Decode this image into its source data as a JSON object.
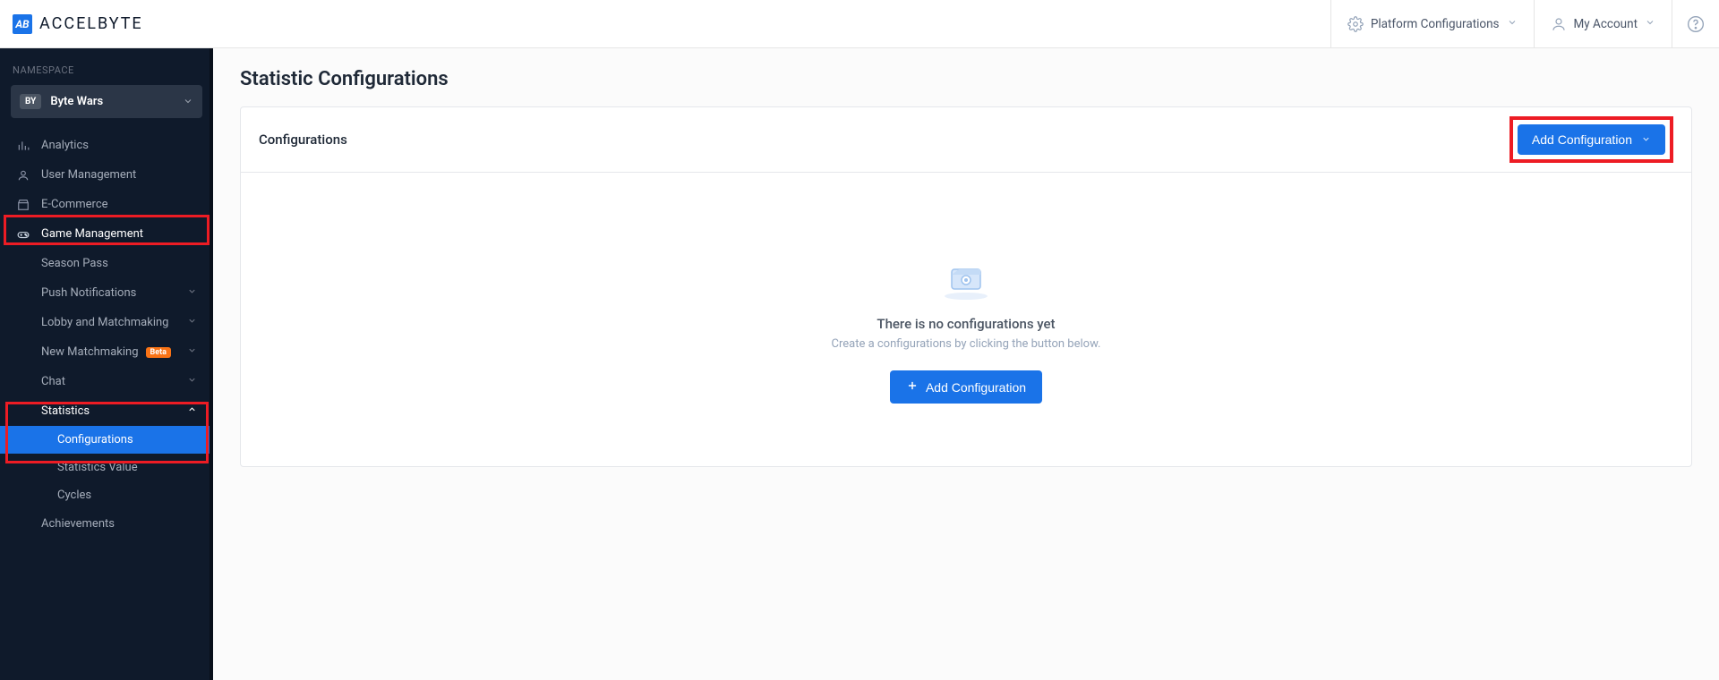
{
  "brand": {
    "logo_initials": "AB",
    "name": "ACCELBYTE"
  },
  "header": {
    "platform_config": "Platform Configurations",
    "my_account": "My Account"
  },
  "sidebar": {
    "namespace_label": "NAMESPACE",
    "namespace_badge": "BY",
    "namespace_name": "Byte Wars",
    "items": {
      "analytics": "Analytics",
      "user_management": "User Management",
      "ecommerce": "E-Commerce",
      "game_management": "Game Management"
    },
    "game_management_children": {
      "season_pass": "Season Pass",
      "push_notifications": "Push Notifications",
      "lobby_matchmaking": "Lobby and Matchmaking",
      "new_matchmaking": "New Matchmaking",
      "new_matchmaking_badge": "Beta",
      "chat": "Chat",
      "statistics": "Statistics",
      "achievements": "Achievements"
    },
    "statistics_children": {
      "configurations": "Configurations",
      "statistics_value": "Statistics Value",
      "cycles": "Cycles"
    }
  },
  "page": {
    "title": "Statistic Configurations",
    "card_title": "Configurations",
    "add_button": "Add Configuration",
    "empty_title": "There is no configurations yet",
    "empty_subtitle": "Create a configurations by clicking the button below.",
    "empty_button": "Add Configuration"
  }
}
